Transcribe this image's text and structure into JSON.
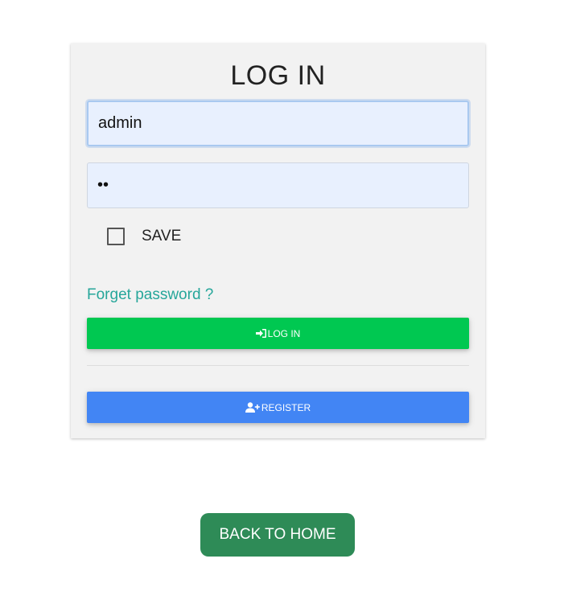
{
  "login_form": {
    "title": "LOG IN",
    "username": {
      "value": "admin",
      "placeholder": ""
    },
    "password": {
      "value": "..",
      "placeholder": ""
    },
    "save": {
      "label": "SAVE",
      "checked": false
    },
    "forgot_password": "Forget password ?",
    "login_button": {
      "label": "LOG IN",
      "icon": "sign-in-icon"
    },
    "register_button": {
      "label": "REGISTER",
      "icon": "user-plus-icon"
    }
  },
  "back_home_button": {
    "label": "BACK TO HOME"
  },
  "colors": {
    "card_bg": "#f2f2f2",
    "input_bg": "#e8f0fe",
    "link": "#26a69a",
    "login": "#00c851",
    "register": "#4285f4",
    "back_home": "#2e8b57"
  }
}
